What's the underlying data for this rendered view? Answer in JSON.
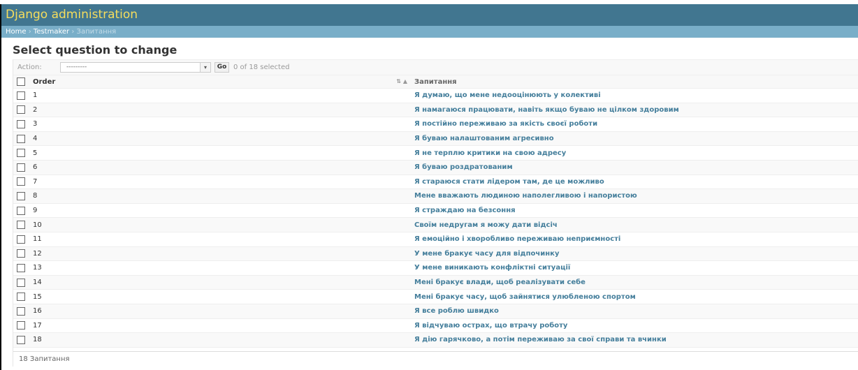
{
  "header": {
    "brand": "Django administration"
  },
  "breadcrumb": {
    "home": "Home",
    "app": "Testmaker",
    "current": "Запитання",
    "sep": "›"
  },
  "page_title": "Select question to change",
  "actions": {
    "label": "Action:",
    "selected_value": "---------",
    "go_label": "Go",
    "selection_count": "0 of 18 selected"
  },
  "table": {
    "columns": [
      "Order",
      "Запитання"
    ],
    "rows": [
      {
        "order": "1",
        "question": "Я думаю, що мене недооцінюють у колективі"
      },
      {
        "order": "2",
        "question": "Я намагаюся працювати, навіть якщо буваю не цілком здоровим"
      },
      {
        "order": "3",
        "question": "Я постійно переживаю за якість своєї роботи"
      },
      {
        "order": "4",
        "question": "Я буваю налаштованим агресивно"
      },
      {
        "order": "5",
        "question": "Я не терплю критики на свою адресу"
      },
      {
        "order": "6",
        "question": "Я буваю роздратованим"
      },
      {
        "order": "7",
        "question": "Я стараюся стати лідером там, де це можливо"
      },
      {
        "order": "8",
        "question": "Мене вважають людиною наполегливою і напористою"
      },
      {
        "order": "9",
        "question": "Я страждаю на безсоння"
      },
      {
        "order": "10",
        "question": "Своїм недругам я можу дати відсіч"
      },
      {
        "order": "11",
        "question": "Я емоційно і хворобливо переживаю неприємності"
      },
      {
        "order": "12",
        "question": "У мене бракує часу для відпочинку"
      },
      {
        "order": "13",
        "question": "У мене виникають конфліктні ситуації"
      },
      {
        "order": "14",
        "question": "Мені бракує влади, щоб реалізувати себе"
      },
      {
        "order": "15",
        "question": "Мені бракує часу, щоб зайнятися улюбленою спортом"
      },
      {
        "order": "16",
        "question": "Я все роблю швидко"
      },
      {
        "order": "17",
        "question": "Я відчуваю острах, що втрачу роботу"
      },
      {
        "order": "18",
        "question": "Я дію гарячково, а потім переживаю за свої справи та вчинки"
      }
    ]
  },
  "paginator": {
    "text": "18 Запитання"
  },
  "colors": {
    "header_bg": "#417690",
    "brand_text": "#f5dd5d",
    "breadcrumb_bg": "#79aec8",
    "link": "#447e9b"
  }
}
